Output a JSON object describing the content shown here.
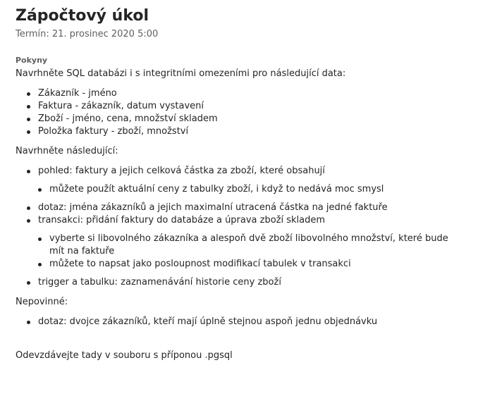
{
  "assignment": {
    "title": "Zápočtový úkol",
    "due": "Termín: 21. prosinec 2020 5:00"
  },
  "instructions": {
    "label": "Pokyny",
    "intro": "Navrhněte SQL databázi i s integritními omezeními pro následující data:",
    "data_items": [
      "Zákazník - jméno",
      "Faktura - zákazník, datum vystavení",
      "Zboží - jméno, cena, množství skladem",
      "Položka faktury - zboží, množství"
    ],
    "design_heading": "Navrhněte následující:",
    "design_items": [
      {
        "text": "pohled: faktury a jejich celková částka za zboží, které obsahují",
        "sub": [
          "můžete použít aktuální ceny z tabulky zboží, i když to nedává moc smysl"
        ]
      },
      {
        "text": "dotaz: jména zákazníků a jejich maximalní utracená částka na jedné faktuře",
        "sub": []
      },
      {
        "text": "transakci: přidání faktury do databáze a úprava zboží skladem",
        "sub": [
          "vyberte si libovolného zákazníka a alespoň dvě zboží libovolného množství, které bude mít na faktuře",
          "můžete to napsat jako posloupnost modifikací tabulek v transakci"
        ]
      },
      {
        "text": "trigger a tabulku: zaznamenávání historie ceny zboží",
        "sub": []
      }
    ],
    "optional_heading": "Nepovinné:",
    "optional_items": [
      "dotaz: dvojce zákazníků, kteří mají úplně stejnou aspoň jednu objednávku"
    ],
    "submit_note": "Odevzdávejte tady v souboru s příponou .pgsql"
  }
}
